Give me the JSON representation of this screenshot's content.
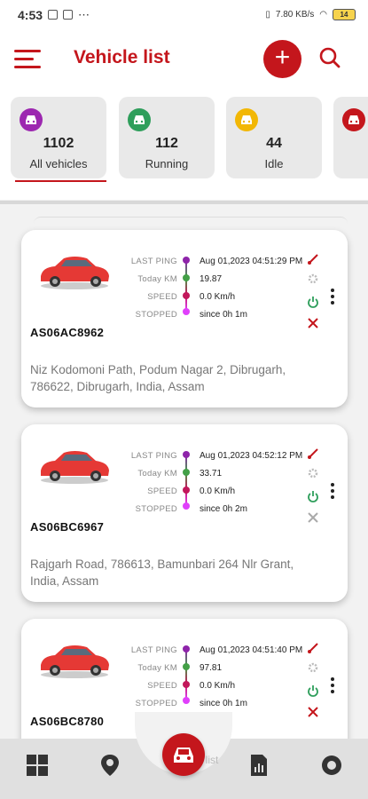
{
  "status_bar": {
    "time": "4:53",
    "network": "7.80 KB/s",
    "battery": "14"
  },
  "header": {
    "title": "Vehicle list"
  },
  "filters": [
    {
      "count": "1102",
      "label": "All vehicles",
      "color": "#9c27b0"
    },
    {
      "count": "112",
      "label": "Running",
      "color": "#2e9e5b"
    },
    {
      "count": "44",
      "label": "Idle",
      "color": "#f2b705"
    },
    {
      "count": "",
      "label": "",
      "color": "#c4161c"
    }
  ],
  "card_labels": {
    "last_ping": "LAST PING",
    "today_km": "Today KM",
    "speed": "SPEED",
    "stopped": "STOPPED"
  },
  "vehicles": [
    {
      "plate": "AS06AC8962",
      "last_ping": "Aug 01,2023 04:51:29 PM",
      "today_km": "19.87",
      "speed": "0.0 Km/h",
      "stopped": "since 0h 1m",
      "address": "Niz Kodomoni Path, Podum Nagar 2, Dibrugarh, 786622, Dibrugarh, India, Assam",
      "immobilizer_color": "#c4161c"
    },
    {
      "plate": "AS06BC6967",
      "last_ping": "Aug 01,2023 04:52:12 PM",
      "today_km": "33.71",
      "speed": "0.0 Km/h",
      "stopped": "since 0h 2m",
      "address": "Rajgarh Road, 786613, Bamunbari 264 Nlr Grant, India, Assam",
      "immobilizer_color": "#aaaaaa"
    },
    {
      "plate": "AS06BC8780",
      "last_ping": "Aug 01,2023 04:51:40 PM",
      "today_km": "97.81",
      "speed": "0.0 Km/h",
      "stopped": "since 0h 1m",
      "address": "",
      "immobilizer_color": "#c4161c"
    }
  ],
  "bottom_nav": {
    "center_label": "Vehicle list"
  },
  "colors": {
    "brand": "#c4161c",
    "power_on": "#2e9e5b"
  },
  "icons": [
    "menu-icon",
    "plus-icon",
    "search-icon",
    "car-icon",
    "signal-icon",
    "settings-icon",
    "power-icon",
    "immobilizer-icon",
    "more-icon",
    "dashboard-icon",
    "location-pin-icon",
    "report-icon",
    "profile-icon"
  ]
}
